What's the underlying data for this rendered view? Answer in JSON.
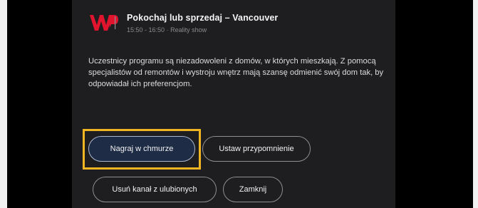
{
  "program": {
    "channel_logo": "wp-logo",
    "title": "Pokochaj lub sprzedaj – Vancouver",
    "time_range": "15:50 - 16:50",
    "separator": "·",
    "genre": "Reality show",
    "description": "Uczestnicy programu są niezadowoleni z domów, w których mieszkają. Z pomocą specjalistów od remontów i wystroju wnętrz mają szansę odmienić swój dom tak, by odpowiadał ich preferencjom."
  },
  "actions": {
    "record_cloud": "Nagraj w chmurze",
    "set_reminder": "Ustaw przypomnienie",
    "remove_favorite": "Usuń kanał z ulubionych",
    "close": "Zamknij"
  },
  "focused_action": "record_cloud",
  "colors": {
    "panel_bg": "#1e1e21",
    "logo_red": "#e1142d",
    "focus_highlight": "#f0b522",
    "focused_button_bg": "#1e2c46"
  }
}
